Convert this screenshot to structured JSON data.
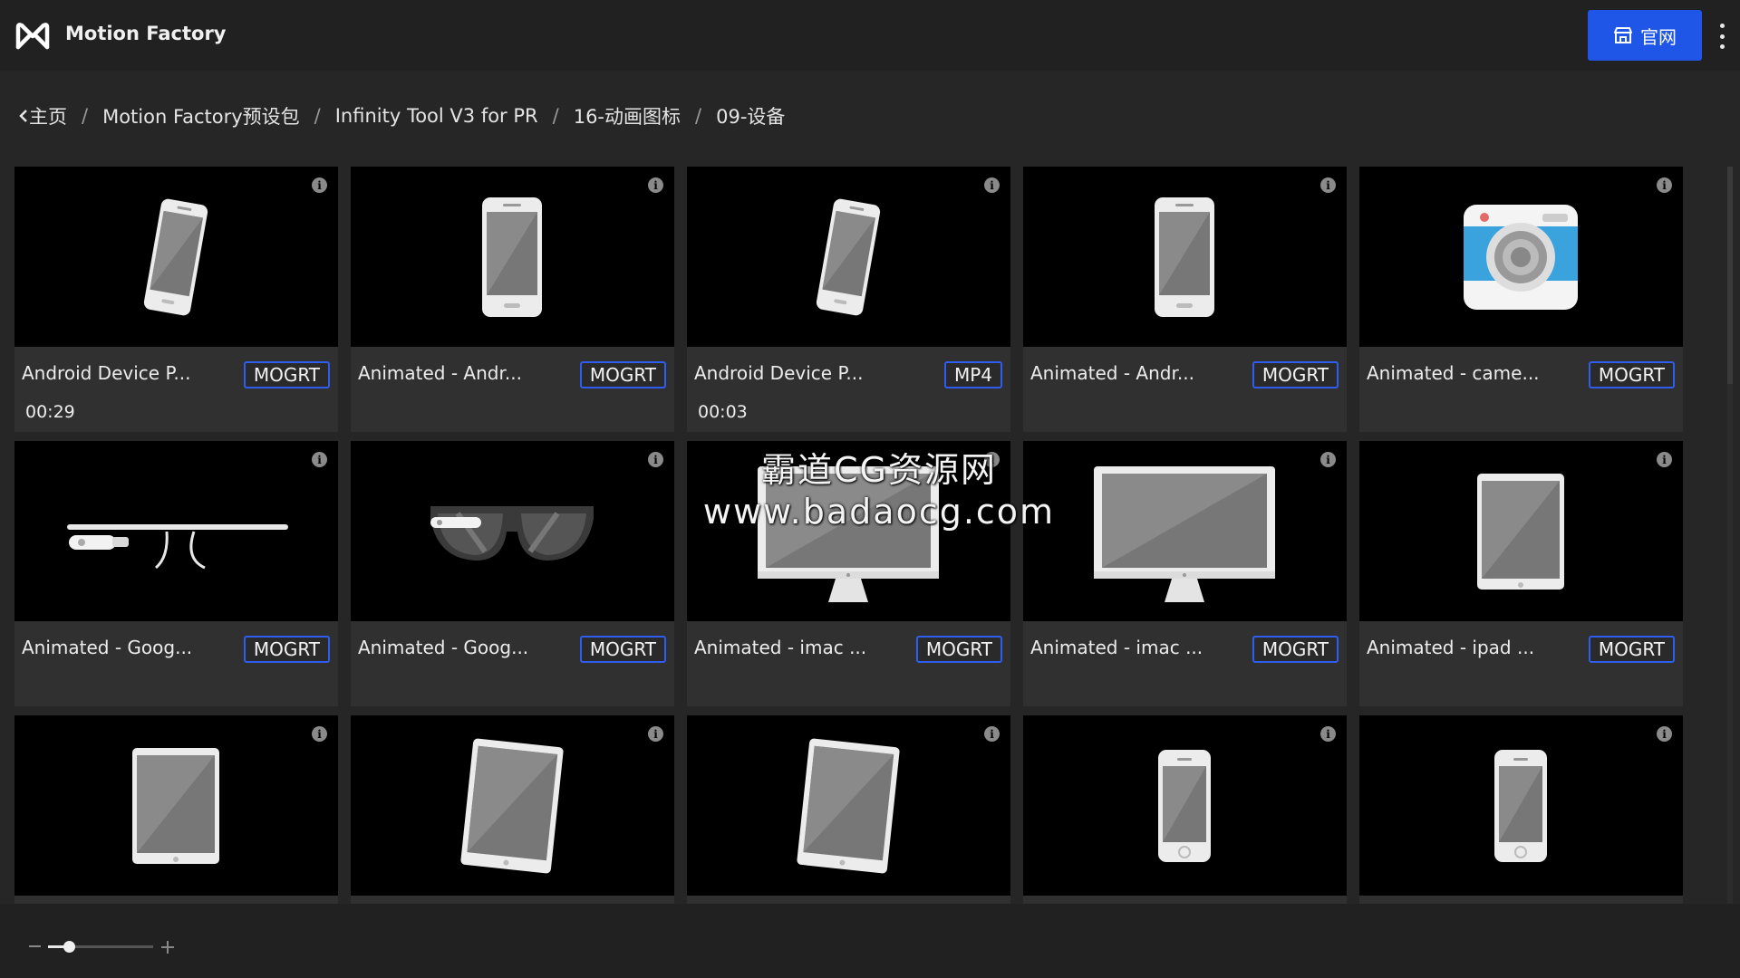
{
  "app": {
    "title": "Motion Factory"
  },
  "header": {
    "site_button_label": "官网"
  },
  "breadcrumb": [
    "主页",
    "Motion Factory预设包",
    "Infinity Tool V3 for PR",
    "16-动画图标",
    "09-设备"
  ],
  "items": [
    {
      "title": "Android Device P...",
      "format": "MOGRT",
      "duration": "00:29",
      "icon": "android-phone-tilted-icon"
    },
    {
      "title": "Animated - Andr...",
      "format": "MOGRT",
      "duration": "",
      "icon": "android-phone-icon"
    },
    {
      "title": "Android Device P...",
      "format": "MP4",
      "duration": "00:03",
      "icon": "android-phone-tilted-icon"
    },
    {
      "title": "Animated - Andr...",
      "format": "MOGRT",
      "duration": "",
      "icon": "android-phone-icon"
    },
    {
      "title": "Animated - came...",
      "format": "MOGRT",
      "duration": "",
      "icon": "camera-icon"
    },
    {
      "title": "Animated - Goog...",
      "format": "MOGRT",
      "duration": "",
      "icon": "google-glass-icon"
    },
    {
      "title": "Animated - Goog...",
      "format": "MOGRT",
      "duration": "",
      "icon": "glasses-icon"
    },
    {
      "title": "Animated - imac ...",
      "format": "MOGRT",
      "duration": "",
      "icon": "imac-icon"
    },
    {
      "title": "Animated - imac ...",
      "format": "MOGRT",
      "duration": "",
      "icon": "imac-icon"
    },
    {
      "title": "Animated - ipad ...",
      "format": "MOGRT",
      "duration": "",
      "icon": "ipad-icon"
    },
    {
      "title": "",
      "format": "",
      "duration": "",
      "icon": "ipad-icon"
    },
    {
      "title": "",
      "format": "",
      "duration": "",
      "icon": "ipad-tilted-icon"
    },
    {
      "title": "",
      "format": "",
      "duration": "",
      "icon": "ipad-tilted-icon"
    },
    {
      "title": "",
      "format": "",
      "duration": "",
      "icon": "iphone-icon"
    },
    {
      "title": "",
      "format": "",
      "duration": "",
      "icon": "iphone-icon"
    }
  ],
  "watermark": {
    "line1": "霸道CG资源网",
    "line2": "www.badaocg.com"
  },
  "zoom": {
    "level": 0.2
  },
  "colors": {
    "accent": "#1f56e8",
    "badge_border": "#2e5df0",
    "background": "#262626",
    "card": "#303030"
  }
}
